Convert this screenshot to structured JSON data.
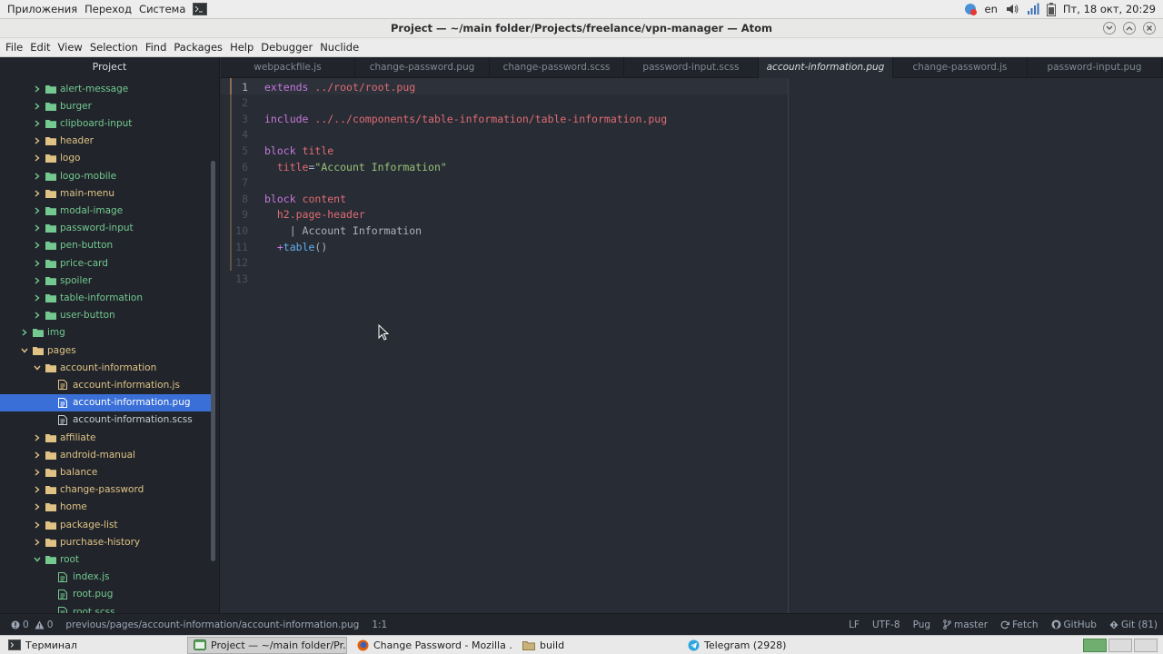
{
  "system_panel": {
    "menus": [
      "Приложения",
      "Переход",
      "Система"
    ],
    "keyboard_layout": "en",
    "datetime": "Пт, 18 окт, 20:29"
  },
  "window": {
    "title": "Project — ~/main folder/Projects/freelance/vpn-manager — Atom"
  },
  "menu_bar": {
    "items": [
      "File",
      "Edit",
      "View",
      "Selection",
      "Find",
      "Packages",
      "Help",
      "Debugger",
      "Nuclide"
    ]
  },
  "tree": {
    "header": "Project",
    "rows": [
      {
        "label": "alert-message",
        "kind": "folder",
        "depth": 3,
        "status": "new"
      },
      {
        "label": "burger",
        "kind": "folder",
        "depth": 3,
        "status": "new"
      },
      {
        "label": "clipboard-input",
        "kind": "folder",
        "depth": 3,
        "status": "new"
      },
      {
        "label": "header",
        "kind": "folder",
        "depth": 3,
        "status": "mod"
      },
      {
        "label": "logo",
        "kind": "folder",
        "depth": 3,
        "status": "mod"
      },
      {
        "label": "logo-mobile",
        "kind": "folder",
        "depth": 3,
        "status": "new"
      },
      {
        "label": "main-menu",
        "kind": "folder",
        "depth": 3,
        "status": "mod"
      },
      {
        "label": "modal-image",
        "kind": "folder",
        "depth": 3,
        "status": "new"
      },
      {
        "label": "password-input",
        "kind": "folder",
        "depth": 3,
        "status": "new"
      },
      {
        "label": "pen-button",
        "kind": "folder",
        "depth": 3,
        "status": "new"
      },
      {
        "label": "price-card",
        "kind": "folder",
        "depth": 3,
        "status": "new"
      },
      {
        "label": "spoiler",
        "kind": "folder",
        "depth": 3,
        "status": "new"
      },
      {
        "label": "table-information",
        "kind": "folder",
        "depth": 3,
        "status": "new"
      },
      {
        "label": "user-button",
        "kind": "folder",
        "depth": 3,
        "status": "new"
      },
      {
        "label": "img",
        "kind": "folder",
        "depth": 2,
        "status": "new"
      },
      {
        "label": "pages",
        "kind": "folder-open",
        "depth": 2,
        "status": "mod"
      },
      {
        "label": "account-information",
        "kind": "folder-open",
        "depth": 3,
        "status": "mod"
      },
      {
        "label": "account-information.js",
        "kind": "file",
        "depth": 4,
        "status": "mod"
      },
      {
        "label": "account-information.pug",
        "kind": "file",
        "depth": 4,
        "status": "selected"
      },
      {
        "label": "account-information.scss",
        "kind": "file",
        "depth": 4,
        "status": "plain"
      },
      {
        "label": "affiliate",
        "kind": "folder",
        "depth": 3,
        "status": "mod"
      },
      {
        "label": "android-manual",
        "kind": "folder",
        "depth": 3,
        "status": "mod"
      },
      {
        "label": "balance",
        "kind": "folder",
        "depth": 3,
        "status": "mod"
      },
      {
        "label": "change-password",
        "kind": "folder",
        "depth": 3,
        "status": "mod"
      },
      {
        "label": "home",
        "kind": "folder",
        "depth": 3,
        "status": "mod"
      },
      {
        "label": "package-list",
        "kind": "folder",
        "depth": 3,
        "status": "mod"
      },
      {
        "label": "purchase-history",
        "kind": "folder",
        "depth": 3,
        "status": "mod"
      },
      {
        "label": "root",
        "kind": "folder-open",
        "depth": 3,
        "status": "new"
      },
      {
        "label": "index.js",
        "kind": "file",
        "depth": 4,
        "status": "new"
      },
      {
        "label": "root.pug",
        "kind": "file",
        "depth": 4,
        "status": "new"
      },
      {
        "label": "root.scss",
        "kind": "file",
        "depth": 4,
        "status": "new"
      }
    ]
  },
  "tabs": [
    {
      "label": "webpackfile.js",
      "active": false
    },
    {
      "label": "change-password.pug",
      "active": false
    },
    {
      "label": "change-password.scss",
      "active": false
    },
    {
      "label": "password-input.scss",
      "active": false
    },
    {
      "label": "account-information.pug",
      "active": true
    },
    {
      "label": "change-password.js",
      "active": false
    },
    {
      "label": "password-input.pug",
      "active": false
    }
  ],
  "editor": {
    "lines": [
      {
        "n": "1",
        "tokens": [
          [
            "kw",
            "extends"
          ],
          [
            "txt",
            " "
          ],
          [
            "tag",
            "../root/root.pug"
          ]
        ]
      },
      {
        "n": "2",
        "tokens": []
      },
      {
        "n": "3",
        "tokens": [
          [
            "kw",
            "include"
          ],
          [
            "txt",
            " "
          ],
          [
            "tag",
            "../../components/table-information/table-information.pug"
          ]
        ]
      },
      {
        "n": "4",
        "tokens": []
      },
      {
        "n": "5",
        "tokens": [
          [
            "kw",
            "block"
          ],
          [
            "txt",
            " "
          ],
          [
            "tag",
            "title"
          ]
        ]
      },
      {
        "n": "6",
        "tokens": [
          [
            "txt",
            "  "
          ],
          [
            "tag",
            "title"
          ],
          [
            "txt",
            "="
          ],
          [
            "str",
            "\"Account Information\""
          ]
        ]
      },
      {
        "n": "7",
        "tokens": []
      },
      {
        "n": "8",
        "tokens": [
          [
            "kw",
            "block"
          ],
          [
            "txt",
            " "
          ],
          [
            "tag",
            "content"
          ]
        ]
      },
      {
        "n": "9",
        "tokens": [
          [
            "txt",
            "  "
          ],
          [
            "tag",
            "h2.page-header"
          ]
        ]
      },
      {
        "n": "10",
        "tokens": [
          [
            "txt",
            "    | Account Information"
          ]
        ]
      },
      {
        "n": "11",
        "tokens": [
          [
            "txt",
            "  "
          ],
          [
            "kw",
            "+"
          ],
          [
            "fn",
            "table"
          ],
          [
            "txt",
            "()"
          ]
        ]
      },
      {
        "n": "12",
        "tokens": []
      },
      {
        "n": "13",
        "tokens": []
      }
    ]
  },
  "status_bar": {
    "errors": "0",
    "warnings": "0",
    "file_path": "previous/pages/account-information/account-information.pug",
    "cursor_pos": "1:1",
    "line_ending": "LF",
    "encoding": "UTF-8",
    "grammar": "Pug",
    "branch": "master",
    "fetch": "Fetch",
    "github": "GitHub",
    "git": "Git (81)"
  },
  "taskbar": {
    "items": [
      {
        "label": "Терминал",
        "active": false
      },
      {
        "label": "Project — ~/main folder/Pr...",
        "active": true
      },
      {
        "label": "Change Password - Mozilla ...",
        "active": false
      },
      {
        "label": "build",
        "active": false
      },
      {
        "label": "Telegram (2928)",
        "active": false
      }
    ]
  }
}
